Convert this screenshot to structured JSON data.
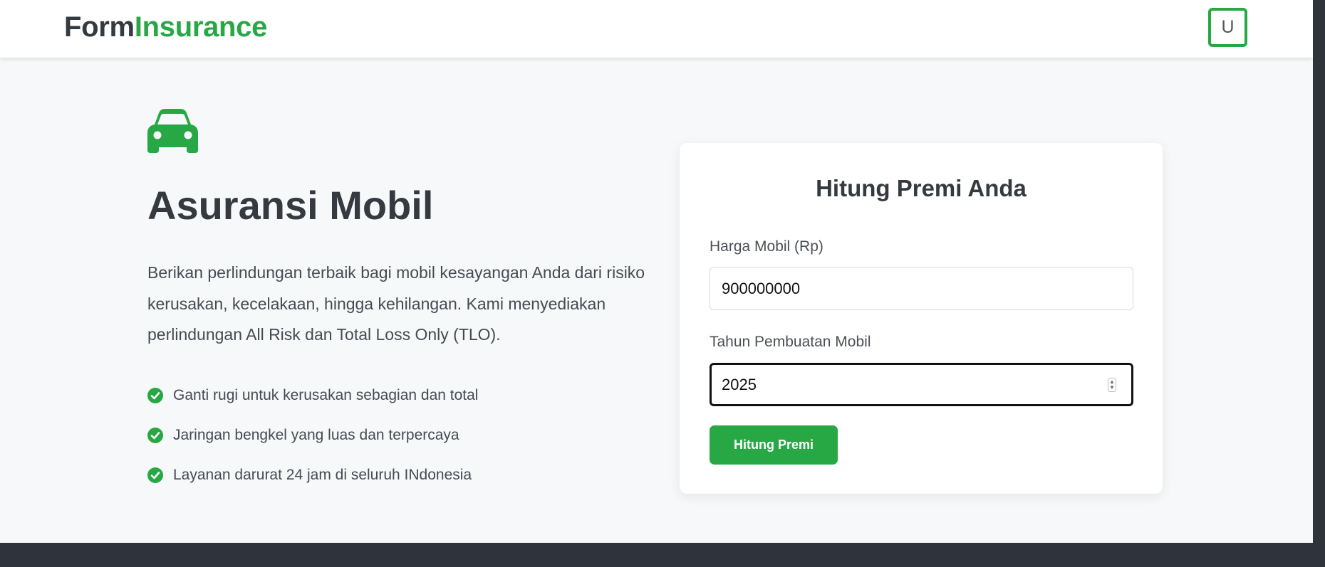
{
  "header": {
    "logo_part1": "Form",
    "logo_part2": "Insurance",
    "user_initial": "U"
  },
  "hero": {
    "icon": "car-icon",
    "title": "Asuransi Mobil",
    "description": "Berikan perlindungan terbaik bagi mobil kesayangan Anda dari risiko kerusakan, kecelakaan, hingga kehilangan. Kami menyediakan perlindungan All Risk dan Total Loss Only (TLO).",
    "features": [
      "Ganti rugi untuk kerusakan sebagian dan total",
      "Jaringan bengkel yang luas dan terpercaya",
      "Layanan darurat 24 jam di seluruh INdonesia"
    ]
  },
  "form": {
    "title": "Hitung Premi Anda",
    "price_label": "Harga Mobil (Rp)",
    "price_value": "900000000",
    "year_label": "Tahun Pembuatan Mobil",
    "year_value": "2025",
    "submit_label": "Hitung Premi"
  },
  "colors": {
    "brand": "#28a745",
    "text_dark": "#343a40",
    "footer": "#2f333c"
  }
}
